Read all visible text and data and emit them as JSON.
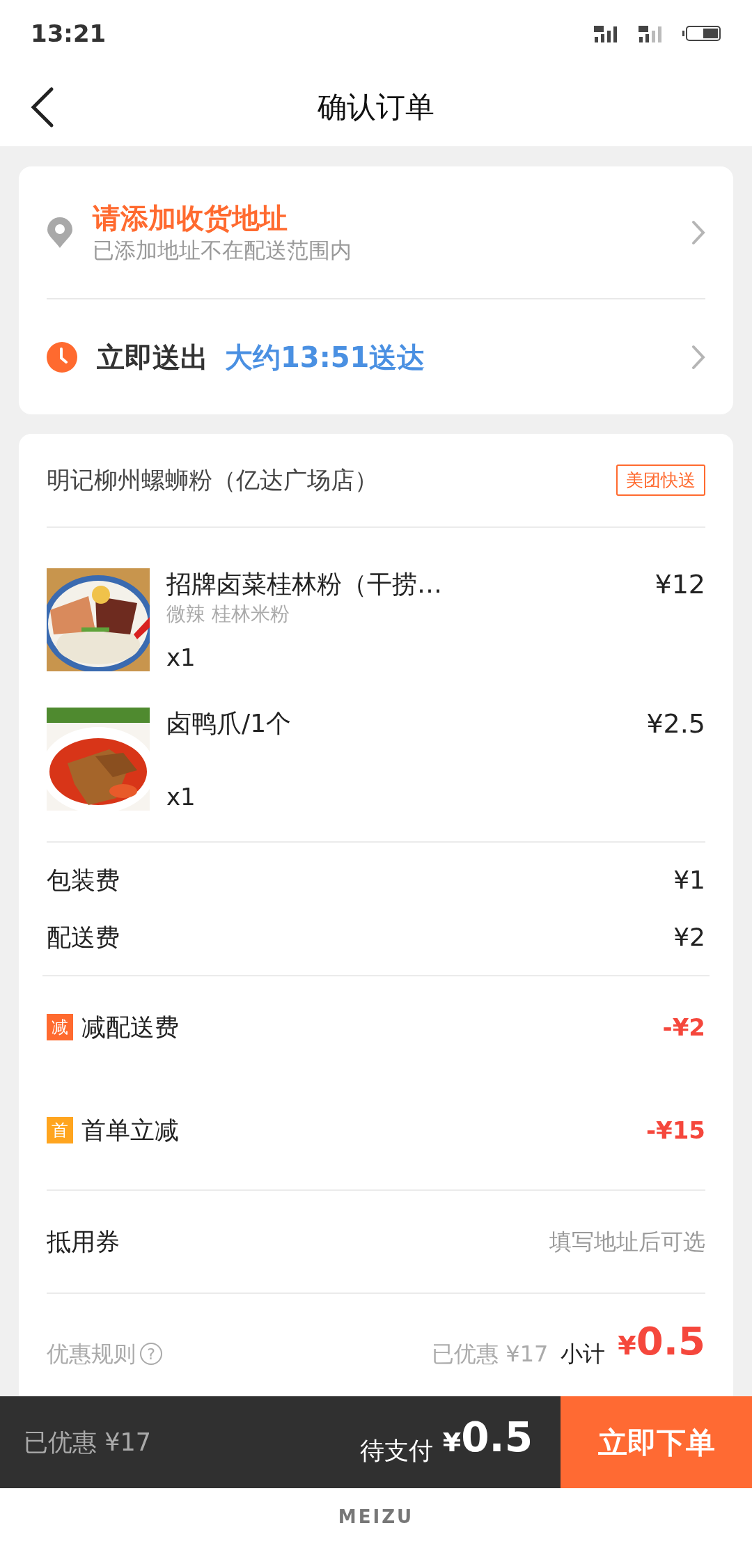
{
  "status_bar": {
    "time": "13:21"
  },
  "header": {
    "title": "确认订单"
  },
  "address": {
    "title": "请添加收货地址",
    "subtitle": "已添加地址不在配送范围内"
  },
  "delivery": {
    "label": "立即送出",
    "eta": "大约13:51送达"
  },
  "shop": {
    "name": "明记柳州螺蛳粉（亿达广场店）",
    "badge": "美团快送"
  },
  "items": [
    {
      "name": "招牌卤菜桂林粉（干捞…",
      "spec": "微辣 桂林米粉",
      "qty": "x1",
      "price": "¥12",
      "kind": "noodles"
    },
    {
      "name": "卤鸭爪/1个",
      "qty": "x1",
      "price": "¥2.5",
      "kind": "feet"
    }
  ],
  "fees": [
    {
      "label": "包装费",
      "value": "¥1"
    },
    {
      "label": "配送费",
      "value": "¥2"
    }
  ],
  "discounts": [
    {
      "tag": "减",
      "label": "减配送费",
      "value": "-¥2",
      "color": "#ff6a2f"
    },
    {
      "tag": "首",
      "label": "首单立减",
      "value": "-¥15",
      "color": "#ffa51f"
    }
  ],
  "voucher": {
    "label": "抵用券",
    "value": "填写地址后可选"
  },
  "summary": {
    "rules": "优惠规则",
    "help": "?",
    "saved": "已优惠 ¥17",
    "subtotal_label": "小计",
    "currency": "¥",
    "amount": "0.5"
  },
  "footer": {
    "saved": "已优惠 ¥17",
    "pay_label": "待支付",
    "currency": "¥",
    "amount": "0.5",
    "button": "立即下单"
  },
  "device": {
    "brand": "MEIZU"
  }
}
